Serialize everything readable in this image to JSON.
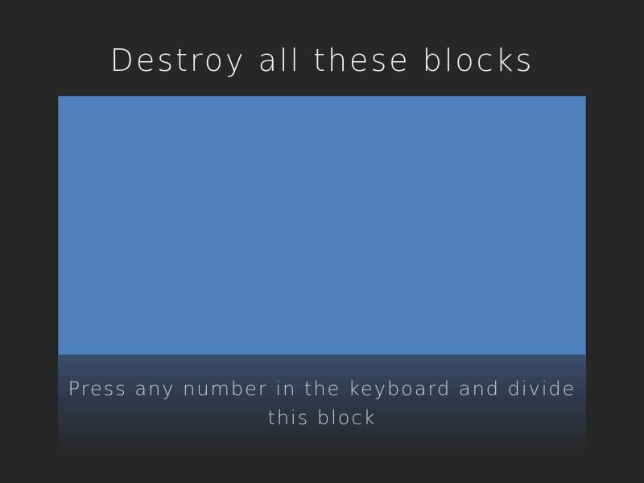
{
  "title": "Destroy all these blocks",
  "instruction": "Press any number in the keyboard and divide this block",
  "colors": {
    "background": "#272727",
    "block": "#4f81bd",
    "title_text": "#f2f2f2",
    "instruction_text": "#c7cfdc"
  }
}
